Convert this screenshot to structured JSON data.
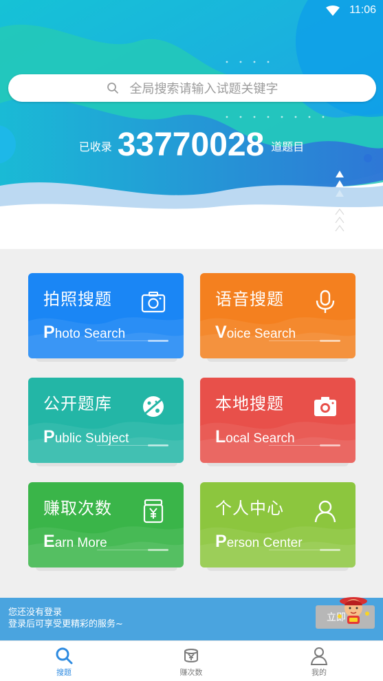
{
  "status": {
    "time": "11:06"
  },
  "search": {
    "placeholder": "全局搜索请输入试题关键字"
  },
  "counter": {
    "prefix": "已收录",
    "count": "33770028",
    "suffix": "道题目"
  },
  "cards": [
    {
      "cn": "拍照搜题",
      "en_initial": "P",
      "en_rest": "hoto Search",
      "icon": "camera-outline-icon",
      "color": "#1a86f5"
    },
    {
      "cn": "语音搜题",
      "en_initial": "V",
      "en_rest": "oice Search",
      "icon": "microphone-icon",
      "color": "#f4801f"
    },
    {
      "cn": "公开题库",
      "en_initial": "P",
      "en_rest": "ublic Subject",
      "icon": "planet-icon",
      "color": "#23b6a6"
    },
    {
      "cn": "本地搜题",
      "en_initial": "L",
      "en_rest": "ocal Search",
      "icon": "camera-filled-icon",
      "color": "#e8504a"
    },
    {
      "cn": "赚取次数",
      "en_initial": "E",
      "en_rest": "arn More",
      "icon": "yen-jar-icon",
      "color": "#3ab549"
    },
    {
      "cn": "个人中心",
      "en_initial": "P",
      "en_rest": "erson Center",
      "icon": "person-icon",
      "color": "#8cc63e"
    }
  ],
  "login_bar": {
    "line1": "您还没有登录",
    "line2": "登录后可享受更精彩的服务~",
    "button": "立即"
  },
  "nav": [
    {
      "label": "搜题",
      "icon": "search-icon",
      "active": true
    },
    {
      "label": "赚次数",
      "icon": "coin-icon",
      "active": false
    },
    {
      "label": "我的",
      "icon": "user-icon",
      "active": false
    }
  ]
}
